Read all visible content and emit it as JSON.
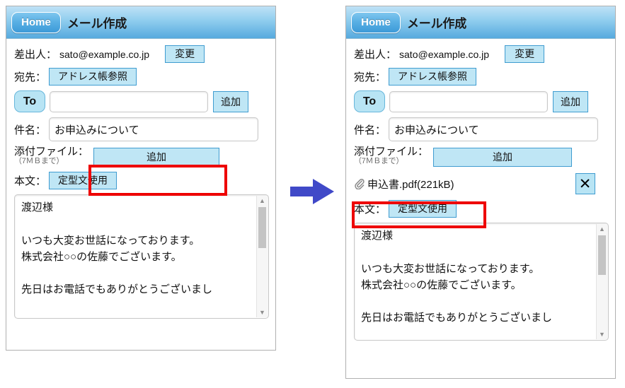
{
  "header": {
    "home_label": "Home",
    "title": "メール作成"
  },
  "form": {
    "sender_label": "差出人：",
    "sender_value": "sato@example.co.jp",
    "change_label": "変更",
    "recipient_label": "宛先：",
    "addressbook_label": "アドレス帳参照",
    "to_label": "To",
    "to_value": "",
    "to_placeholder": "",
    "add_recipient_label": "追加",
    "subject_label": "件名：",
    "subject_value": "お申込みについて",
    "attach_label_main": "添付ファイル：",
    "attach_label_sub": "（7ＭＢまで）",
    "attach_add_label": "追加",
    "body_label": "本文：",
    "template_label": "定型文使用",
    "body_value": "渡辺様\n\nいつも大変お世話になっております。\n株式会社○○の佐藤でございます。\n\n先日はお電話でもありがとうございまし"
  },
  "attachment": {
    "clip_icon": "paperclip-icon",
    "file_name": "申込書.pdf(221kB)",
    "delete_glyph": "✕"
  },
  "annotations": {
    "arrow_icon": "right-arrow-icon",
    "arrow_color": "#4049c8",
    "highlight_color": "#ee0000"
  }
}
